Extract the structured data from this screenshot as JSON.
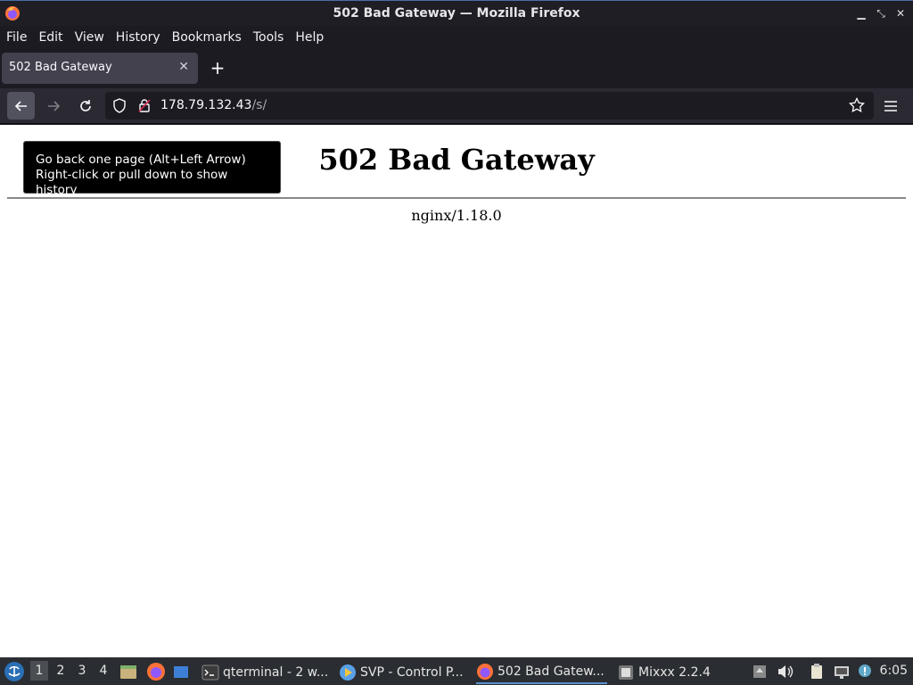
{
  "window": {
    "title": "502 Bad Gateway — Mozilla Firefox",
    "controls": [
      "minimize",
      "restore",
      "close"
    ]
  },
  "menu": {
    "items": [
      "File",
      "Edit",
      "View",
      "History",
      "Bookmarks",
      "Tools",
      "Help"
    ]
  },
  "tabs": [
    {
      "title": "502 Bad Gateway",
      "active": true
    }
  ],
  "urlbar": {
    "host": "178.79.132.43",
    "path": "/s/"
  },
  "tooltip": {
    "line1": "Go back one page (Alt+Left Arrow)",
    "line2": "Right-click or pull down to show history"
  },
  "page": {
    "heading": "502 Bad Gateway",
    "server": "nginx/1.18.0"
  },
  "taskbar": {
    "workspaces": [
      "1",
      "2",
      "3",
      "4"
    ],
    "active_workspace": "1",
    "tasks": [
      {
        "label": "qterminal - 2 w...",
        "icon": "terminal-icon"
      },
      {
        "label": "SVP - Control P...",
        "icon": "svp-icon"
      },
      {
        "label": "502 Bad Gatew...",
        "icon": "firefox-icon",
        "active": true
      },
      {
        "label": "Mixxx 2.2.4",
        "icon": "mixxx-icon"
      }
    ],
    "clock": "6:05"
  },
  "colors": {
    "accent": "#5a8fd0",
    "toolbar": "#2b2a33",
    "tab_active": "#42414d"
  }
}
